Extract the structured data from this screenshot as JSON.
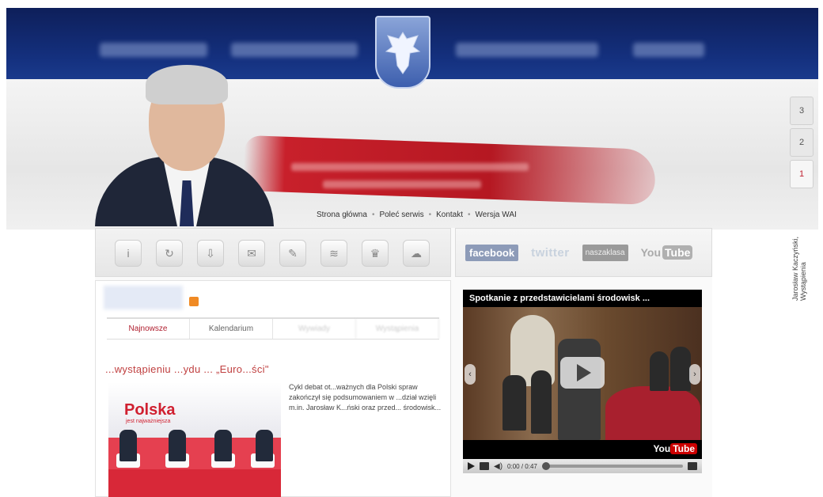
{
  "top_nav": {
    "items": [
      "Jarosław Kaczyński",
      "Wydarzenia",
      "Galeria zdjęć",
      "Kontakt"
    ]
  },
  "top_menu": {
    "items": [
      "Strona główna",
      "Poleć serwis",
      "Kontakt",
      "Wersja WAI"
    ],
    "separator": "•"
  },
  "side_tabs": {
    "items": [
      "3",
      "2",
      "1"
    ],
    "label": "Jarosław Kaczyński, Wystąpienia"
  },
  "icon_bar": {
    "icons": [
      "info-icon",
      "refresh-icon",
      "download-icon",
      "mail-icon",
      "chat-icon",
      "car-icon",
      "eagle-icon",
      "cloud-icon"
    ],
    "glyphs": [
      "i",
      "↻",
      "⇩",
      "✉",
      "✎",
      "≋",
      "♛",
      "☁"
    ]
  },
  "social": {
    "facebook": "facebook",
    "twitter": "twitter",
    "nasza_klasa": "naszaklasa",
    "youtube_you": "You",
    "youtube_tube": "Tube"
  },
  "news": {
    "tabs": [
      "Najnowsze",
      "Kalendarium",
      "Wywiady",
      "Wystąpienia"
    ],
    "headline_visible": "...wystąpieniu ...ydu ... „Euro...ści\"",
    "excerpt": "Cykl debat ot...ważnych dla Polski spraw zakończył się podsumowaniem w ...dział wzięli m.in. Jarosław K...ński oraz przed... środowisk...",
    "thumbnail": {
      "banner_title": "Polska",
      "banner_sub": "jest najważniejsza"
    }
  },
  "video": {
    "title": "Spotkanie z przedstawicielami środowisk ...",
    "time": "0:00 / 0:47",
    "logo_you": "You",
    "logo_tube": "Tube",
    "progress": 0.0
  }
}
